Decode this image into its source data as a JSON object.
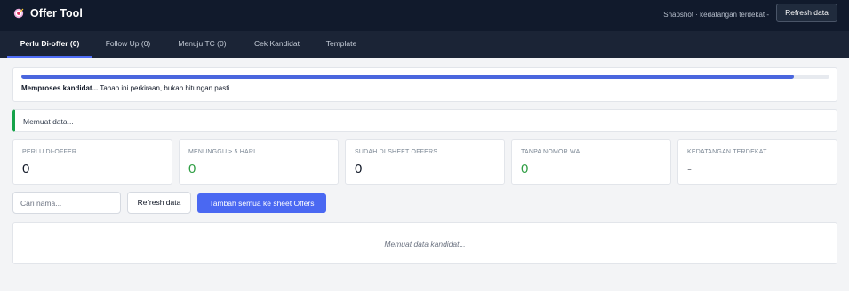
{
  "app": {
    "title": "Offer Tool",
    "logo_icon": "target-icon"
  },
  "header": {
    "snapshot_text": "Snapshot · kedatangan terdekat -",
    "refresh_label": "Refresh data"
  },
  "tabs": [
    {
      "label": "Perlu Di-offer (0)",
      "active": true
    },
    {
      "label": "Follow Up (0)",
      "active": false
    },
    {
      "label": "Menuju TC (0)",
      "active": false
    },
    {
      "label": "Cek Kandidat",
      "active": false
    },
    {
      "label": "Template",
      "active": false
    }
  ],
  "progress": {
    "fraction": 0.956,
    "bold_text": "Memproses kandidat...",
    "text": "Tahap ini perkiraan, bukan hitungan pasti."
  },
  "status": {
    "message": "Memuat data..."
  },
  "stats": [
    {
      "label": "PERLU DI-OFFER",
      "value": "0",
      "color": "#111827"
    },
    {
      "label": "MENUNGGU ≥ 5 HARI",
      "value": "0",
      "color": "#2f9e44"
    },
    {
      "label": "SUDAH DI SHEET OFFERS",
      "value": "0",
      "color": "#111827"
    },
    {
      "label": "TANPA NOMOR WA",
      "value": "0",
      "color": "#2f9e44"
    },
    {
      "label": "KEDATANGAN TERDEKAT",
      "value": "-",
      "color": "#111827"
    }
  ],
  "controls": {
    "search_placeholder": "Cari nama...",
    "search_value": "",
    "refresh_label": "Refresh data",
    "add_all_label": "Tambah semua ke sheet Offers"
  },
  "list": {
    "empty_message": "Memuat data kandidat..."
  },
  "colors": {
    "header_bg": "#111a2c",
    "tab_bar_bg": "#1b2436",
    "accent": "#4a68f2",
    "success": "#2f9e44"
  }
}
